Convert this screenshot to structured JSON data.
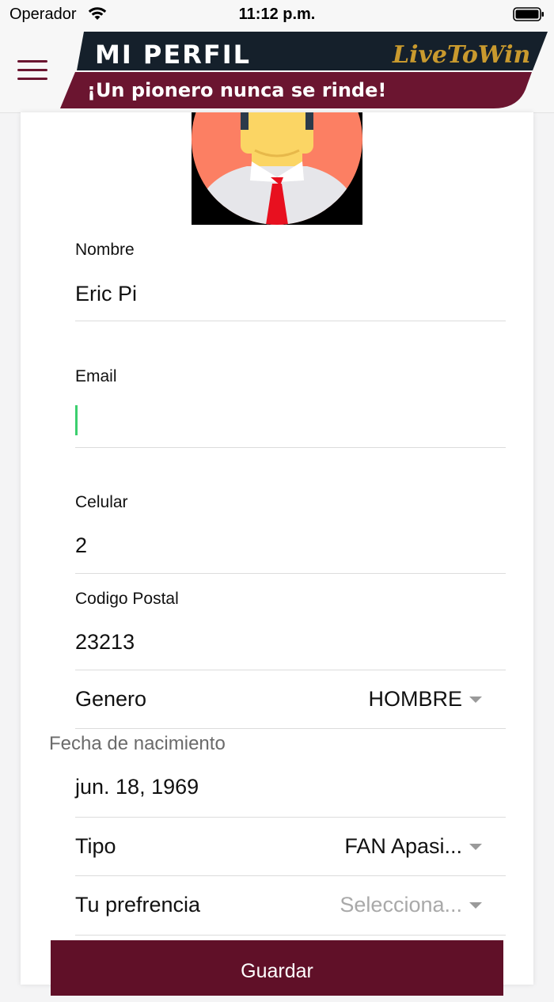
{
  "status_bar": {
    "carrier": "Operador",
    "time": "11:12 p.m."
  },
  "header": {
    "title": "MI PERFIL",
    "subtitle": "¡Un pionero nunca se rinde!",
    "logo_text": "LiveToWin",
    "menu_icon": "hamburger-menu-icon",
    "colors": {
      "dark_band": "#15202b",
      "maroon": "#6b1530",
      "gold": "#c99a2e"
    }
  },
  "form": {
    "nombre": {
      "label": "Nombre",
      "value": "Eric Pi"
    },
    "email": {
      "label": "Email",
      "value": ""
    },
    "celular": {
      "label": "Celular",
      "value": "2"
    },
    "codigo_postal": {
      "label": "Codigo Postal",
      "value": "23213"
    },
    "genero": {
      "label": "Genero",
      "value": "HOMBRE"
    },
    "fecha": {
      "label": "Fecha de nacimiento",
      "value": "jun. 18, 1969"
    },
    "tipo": {
      "label": "Tipo",
      "value": "FAN Apasi..."
    },
    "preferencia": {
      "label": "Tu prefrencia",
      "placeholder": "Selecciona..."
    }
  },
  "save_button": {
    "label": "Guardar",
    "color": "#601028"
  }
}
